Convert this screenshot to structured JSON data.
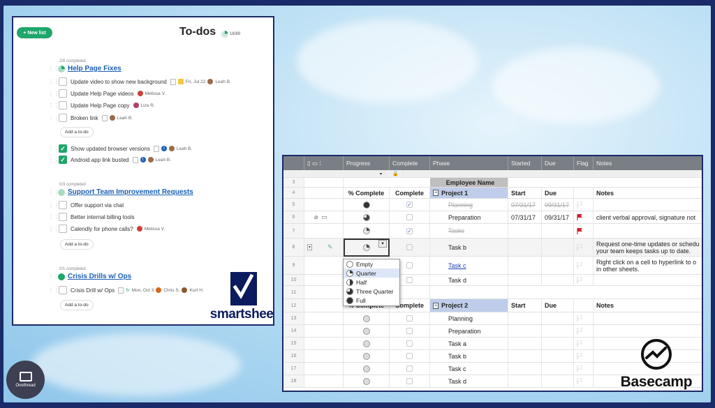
{
  "todo_panel": {
    "new_list_label": "New list",
    "title": "To-dos",
    "overall_count": "16/89",
    "lists": [
      {
        "completed": "2/8 completed",
        "name": "Help Page Fixes",
        "items": [
          {
            "text": "Update video to show new background",
            "date": "Fri, Jul 22",
            "assignee": "Leah B.",
            "done": false
          },
          {
            "text": "Update Help Page videos",
            "assignee": "Melissa V.",
            "done": false
          },
          {
            "text": "Update Help Page copy",
            "assignee": "Liza R.",
            "done": false
          },
          {
            "text": "Broken link",
            "assignee": "Leah B.",
            "done": false
          }
        ],
        "add_label": "Add a to-do",
        "done_items": [
          {
            "text": "Show updated browser versions",
            "count": "1",
            "assignee": "Leah B.",
            "done": true
          },
          {
            "text": "Android app link busted",
            "count": "1",
            "assignee": "Leah B.",
            "done": true
          }
        ]
      },
      {
        "completed": "0/3 completed",
        "name": "Support Team Improvement Requests",
        "items": [
          {
            "text": "Offer support via chat",
            "done": false
          },
          {
            "text": "Better internal billing tools",
            "done": false
          },
          {
            "text": "Calendly for phone calls?",
            "assignee": "Melissa V.",
            "done": false
          }
        ],
        "add_label": "Add a to-do"
      },
      {
        "completed": "0/1 completed",
        "name": "Crisis Drills w/ Ops",
        "items": [
          {
            "text": "Crisis Drill w/ Ops",
            "date": "Mon, Oct 3",
            "assignee": "Chris S.",
            "assignee2": "Kurt H.",
            "done": false
          }
        ],
        "add_label": "Add a to-do"
      }
    ],
    "brand_word": "smartsheet"
  },
  "grid_panel": {
    "headers": [
      "Progress",
      "Complete",
      "Phase",
      "Started",
      "Due",
      "Flag",
      "Notes"
    ],
    "rows": [
      {
        "num": "3",
        "phase": "Employee Name",
        "kind": "empname"
      },
      {
        "num": "4",
        "pct": "% Complete",
        "complete": "Complete",
        "phase": "Project 1",
        "start": "Start",
        "due": "Due",
        "notes": "Notes",
        "kind": "project"
      },
      {
        "num": "5",
        "harvey": "full",
        "checked": true,
        "phase": "Planning",
        "start": "07/31/17",
        "due": "09/31/17",
        "kind": "strike"
      },
      {
        "num": "6",
        "harvey": "threequarter",
        "phase": "Preparation",
        "start": "07/31/17",
        "due": "09/31/17",
        "flag": true,
        "notes": "client verbal approval, signature not",
        "kind": "task"
      },
      {
        "num": "7",
        "harvey": "quarter",
        "checked": true,
        "phase": "Tasks",
        "flag": true,
        "kind": "strike"
      },
      {
        "num": "8",
        "harvey": "quarter",
        "phase": "Task b",
        "notes": "Request one-time updates or schedu",
        "notes2": "your team keeps tasks up to date.",
        "kind": "task"
      },
      {
        "num": "9",
        "phase": "Task c",
        "notes": "Right click on a cell to hyperlink to o",
        "notes2": "in other sheets.",
        "kind": "link"
      },
      {
        "num": "10",
        "phase": "Task d",
        "kind": "task"
      },
      {
        "num": "11",
        "kind": "blank"
      },
      {
        "num": "12",
        "pct": "% Complete",
        "complete": "Complete",
        "phase": "Project 2",
        "start": "Start",
        "due": "Due",
        "notes": "Notes",
        "kind": "project"
      },
      {
        "num": "13",
        "harvey": "empty",
        "phase": "Planning",
        "kind": "task"
      },
      {
        "num": "14",
        "harvey": "empty",
        "phase": "Preparation",
        "kind": "task"
      },
      {
        "num": "15",
        "harvey": "empty",
        "phase": "Task a",
        "kind": "task"
      },
      {
        "num": "16",
        "harvey": "empty",
        "phase": "Task b",
        "kind": "task"
      },
      {
        "num": "17",
        "harvey": "empty",
        "phase": "Task c",
        "kind": "task"
      },
      {
        "num": "18",
        "harvey": "empty",
        "phase": "Task d",
        "kind": "task"
      }
    ],
    "dropdown_options": [
      "Empty",
      "Quarter",
      "Half",
      "Three Quarter",
      "Full"
    ],
    "dropdown_selected": "Quarter",
    "brand_word": "Basecamp"
  },
  "watermark": "Onethread",
  "colors": {
    "green": "#1fa66a",
    "navy": "#1b2a68",
    "link": "#1a5fb4",
    "flag": "#d0202a",
    "project_row": "#bfcdea"
  }
}
